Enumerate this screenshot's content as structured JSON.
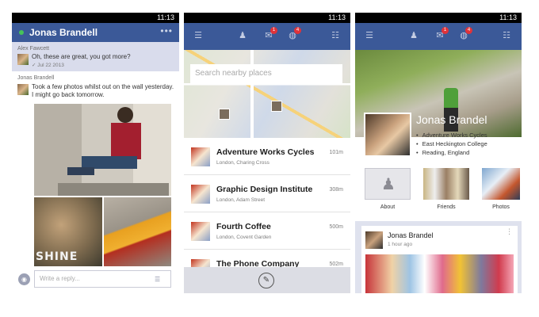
{
  "statusbar": {
    "time": "11:13"
  },
  "chat": {
    "contact_name": "Jonas Brandell",
    "more": "•••",
    "messages": [
      {
        "sender": "Alex Fawcett",
        "text": "Oh, these are great, you got more?",
        "meta": "✓ Jul 22 2013"
      },
      {
        "sender": "Jonas Brandell",
        "text_line1": "Took a few photos whilst out on the wall yesterday.",
        "text_line2": "I might go back tomorrow."
      }
    ],
    "photo_caption_visible": "SHINE",
    "reply_placeholder": "Write a reply...",
    "camera_icon": "camera-icon",
    "emoji_icon": "emoji-icon"
  },
  "nav": {
    "menu_icon": "menu-icon",
    "friends_icon": "friends-icon",
    "messages_icon": "messages-icon",
    "notifications_icon": "globe-icon",
    "contacts_icon": "contacts-list-icon",
    "messages_badge": "1",
    "notifications_badge": "4"
  },
  "nearby": {
    "search_placeholder": "Search nearby places",
    "places": [
      {
        "name": "Adventure Works Cycles",
        "address": "London, Charing Cross",
        "distance": "101m"
      },
      {
        "name": "Graphic Design Institute",
        "address": "London, Adam Street",
        "distance": "308m"
      },
      {
        "name": "Fourth Coffee",
        "address": "London, Covent Garden",
        "distance": "500m"
      },
      {
        "name": "The Phone Company",
        "address": "",
        "distance": "502m"
      }
    ],
    "pin_icon": "pin-icon"
  },
  "profile": {
    "name": "Jonas Brandel",
    "info": [
      "Adventure Works Cycles",
      "East Heckington College",
      "Reading, England"
    ],
    "tiles": [
      "About",
      "Friends",
      "Photos"
    ],
    "post": {
      "author": "Jonas Brandel",
      "time": "1 hour ago",
      "more": "⋮"
    }
  },
  "colors": {
    "facebook_blue": "#3b5998",
    "badge_red": "#e0333a",
    "chat_highlight": "#d9dcec"
  }
}
